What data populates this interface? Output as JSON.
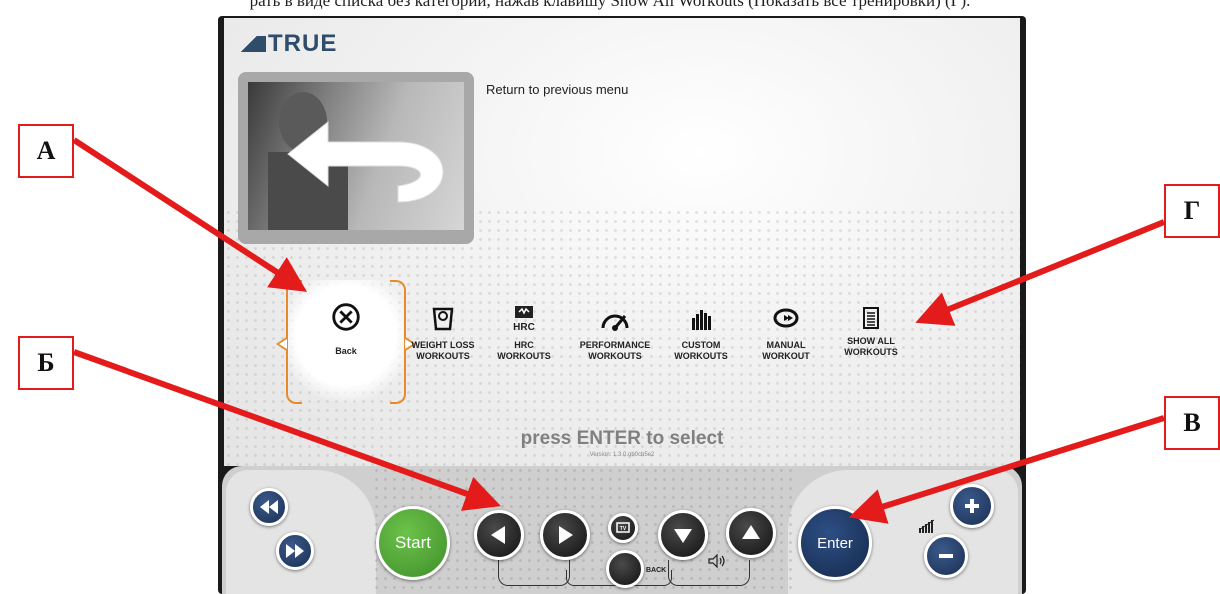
{
  "caption": "рать в виде списка без категории, нажав клавишу Show All Workouts (Показать все тренировки) (Г).",
  "brand": "TRUE",
  "preview_caption": "Return to previous menu",
  "menu_items": [
    {
      "label": "Back",
      "icon": "close-circle-icon",
      "selected": true
    },
    {
      "label": "WEIGHT LOSS WORKOUTS",
      "icon": "scale-icon",
      "selected": false
    },
    {
      "label": "HRC WORKOUTS",
      "icon": "hrc-icon",
      "selected": false
    },
    {
      "label": "PERFORMANCE WORKOUTS",
      "icon": "gauge-icon",
      "selected": false
    },
    {
      "label": "CUSTOM WORKOUTS",
      "icon": "bar-profile-icon",
      "selected": false
    },
    {
      "label": "MANUAL WORKOUT",
      "icon": "manual-loop-icon",
      "selected": false
    },
    {
      "label": "SHOW ALL WORKOUTS",
      "icon": "list-document-icon",
      "selected": false
    }
  ],
  "press_enter": "press ENTER to select",
  "version": "Version: 1.3.0.gb0cb5e2",
  "console": {
    "start": "Start",
    "enter": "Enter",
    "back": "BACK",
    "tv": "TV"
  },
  "callouts": {
    "a": "А",
    "b": "Б",
    "v": "В",
    "g": "Г"
  },
  "colors": {
    "accent": "#e88a2a",
    "navy": "#1b2f52",
    "green": "#4fa636",
    "callout": "#e31b1b"
  }
}
